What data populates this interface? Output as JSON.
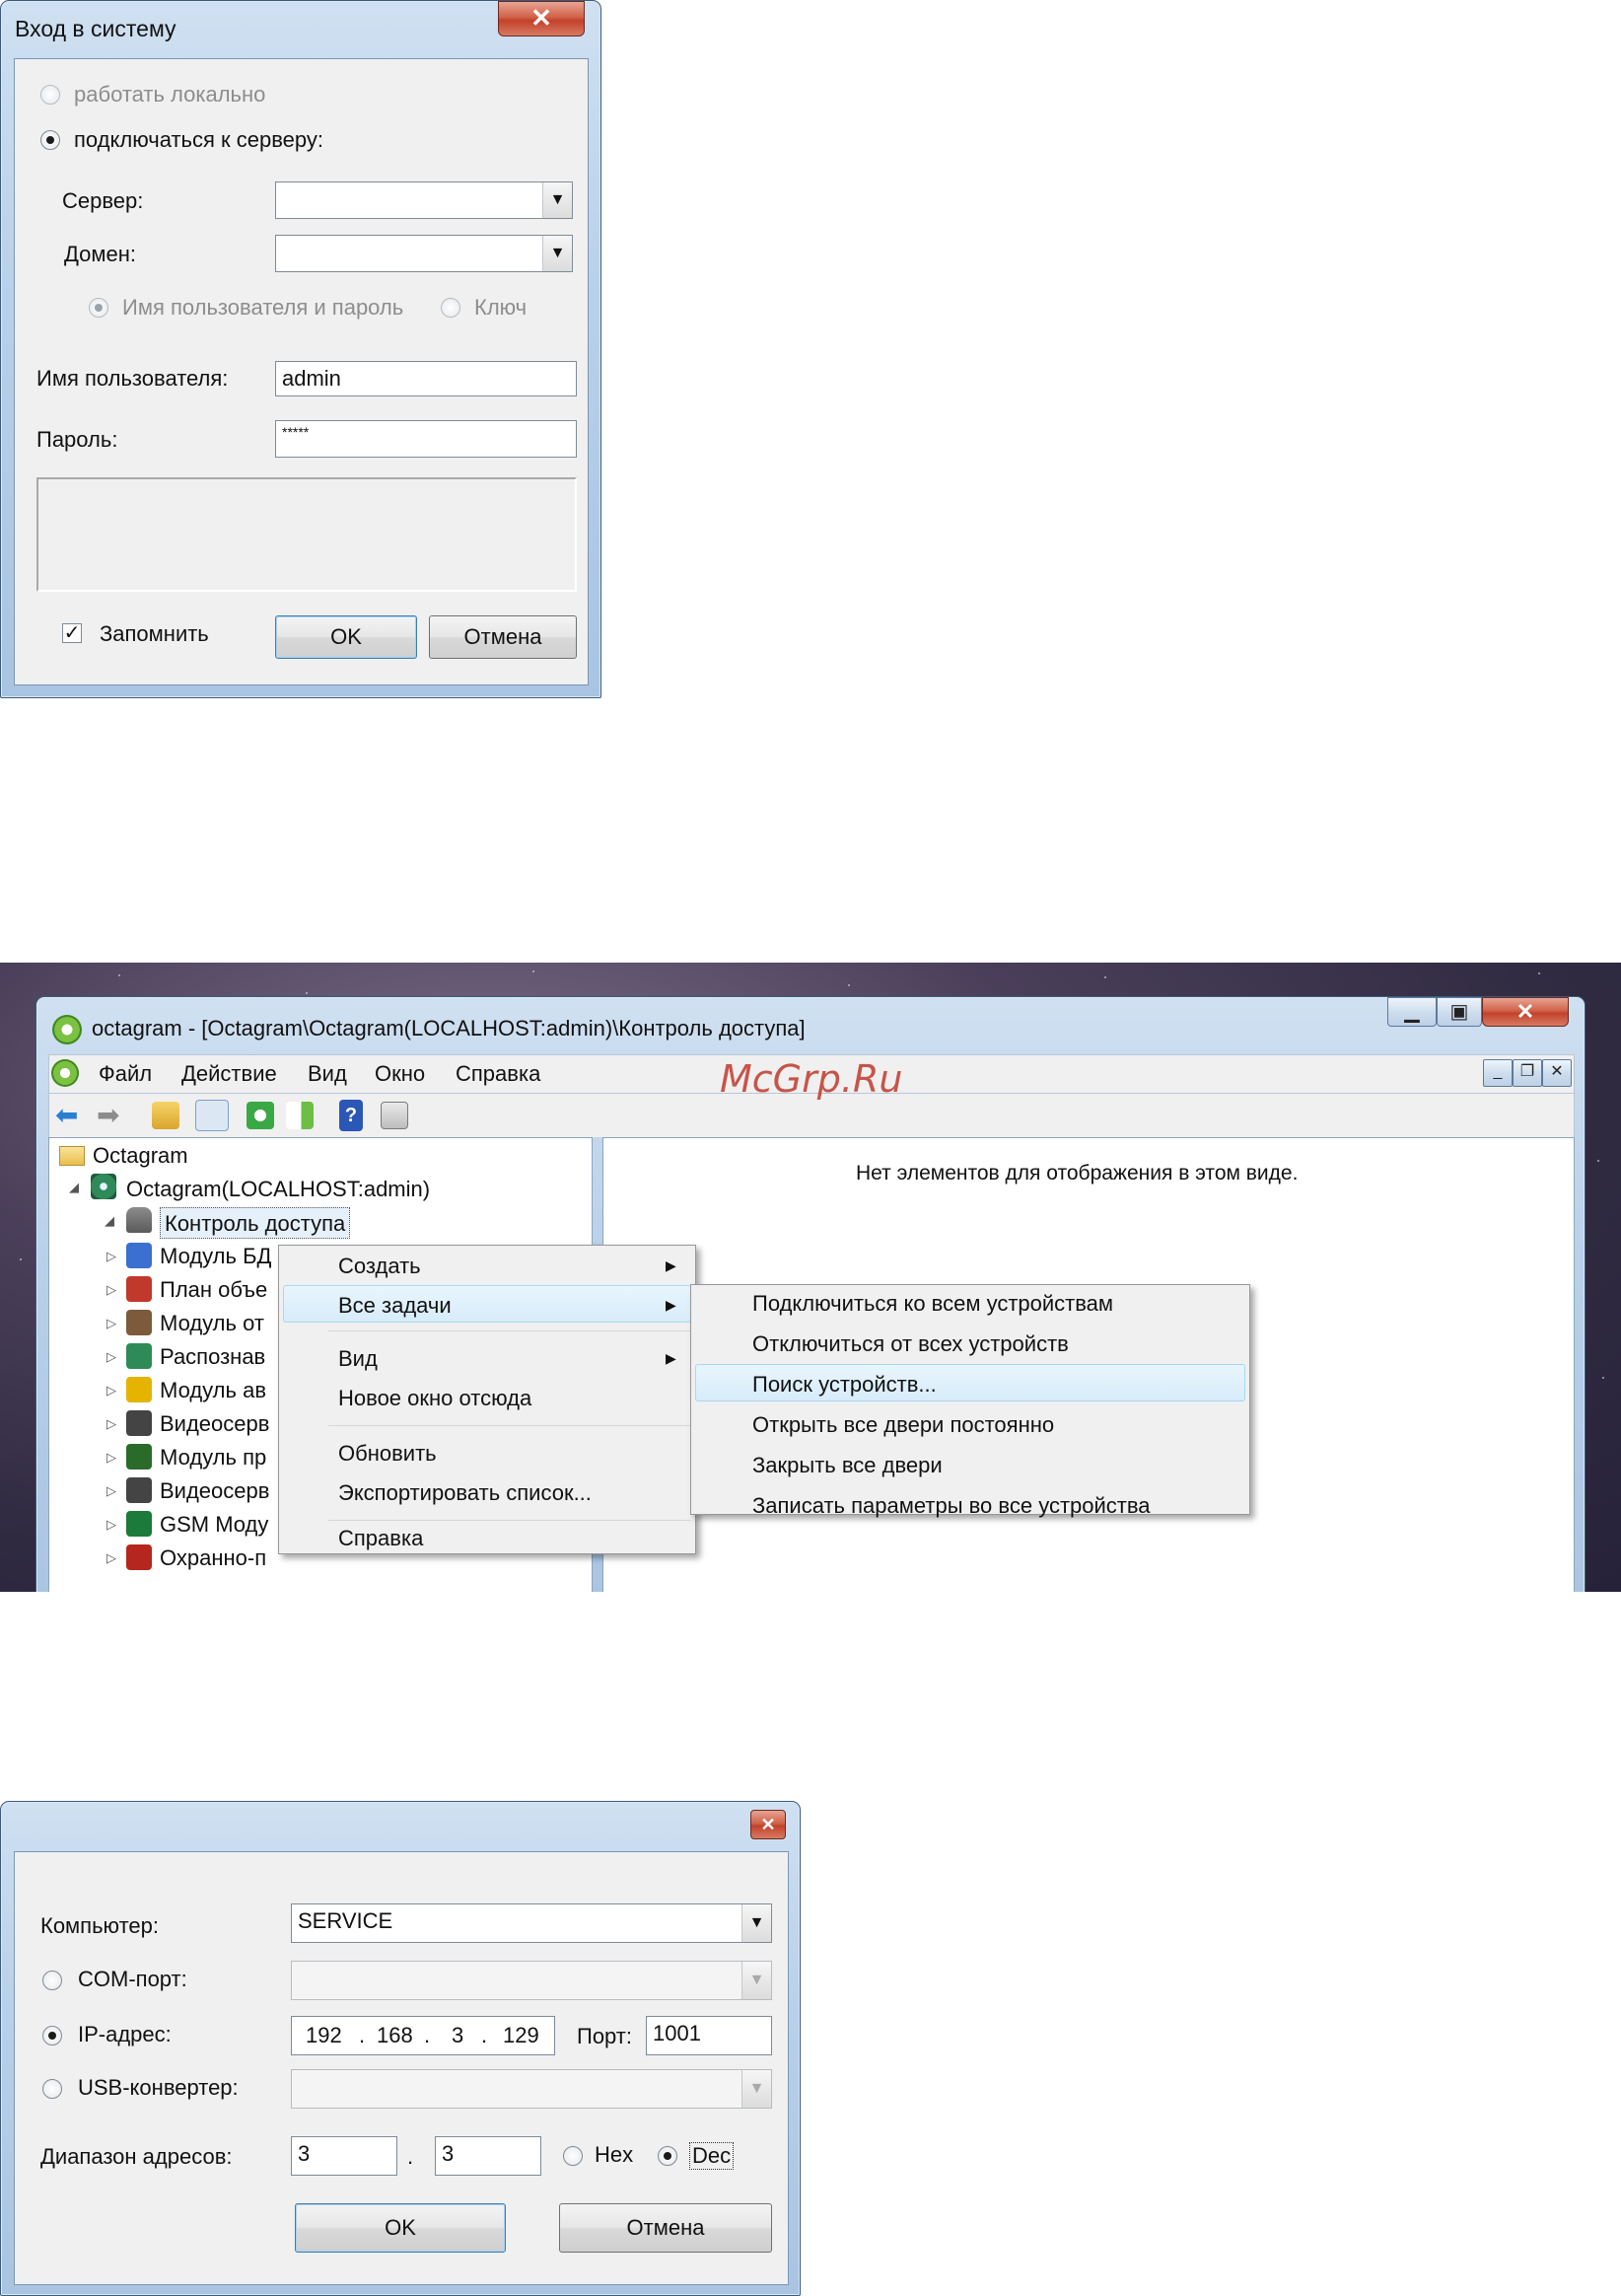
{
  "login": {
    "title": "Вход в систему",
    "close_glyph": "✕",
    "mode_local": "работать локально",
    "mode_server": "подключаться к серверу:",
    "server_label": "Сервер:",
    "server_value": "",
    "domain_label": "Домен:",
    "domain_value": "",
    "auth_userpass": "Имя пользователя и пароль",
    "auth_key": "Ключ",
    "username_label": "Имя пользователя:",
    "username_value": "admin",
    "password_label": "Пароль:",
    "password_value": "*****",
    "remember_label": "Запомнить",
    "ok": "OK",
    "cancel": "Отмена"
  },
  "app": {
    "title": "octagram - [Octagram\\Octagram(LOCALHOST:admin)\\Контроль доступа]",
    "menu": [
      "Файл",
      "Действие",
      "Вид",
      "Окно",
      "Справка"
    ],
    "watermark": "McGrp.Ru",
    "empty_message": "Нет элементов для отображения в этом виде.",
    "tree": {
      "root": "Octagram",
      "server": "Octagram(LOCALHOST:admin)",
      "selected": "Контроль доступа",
      "items": [
        "Модуль БД",
        "План объе",
        "Модуль от",
        "Распознав",
        "Модуль ав",
        "Видеосерв",
        "Модуль пр",
        "Видеосерв",
        "GSM Моду",
        "Охранно-п"
      ]
    },
    "context_menu": {
      "create": "Создать",
      "all_tasks": "Все задачи",
      "view": "Вид",
      "new_window": "Новое окно отсюда",
      "refresh": "Обновить",
      "export": "Экспортировать список...",
      "help": "Справка"
    },
    "submenu": [
      "Подключиться ко всем устройствам",
      "Отключиться от всех устройств",
      "Поиск устройств...",
      "Открыть все двери постоянно",
      "Закрыть все двери",
      "Записать параметры во все устройства"
    ],
    "icons": {
      "app": "gear-icon",
      "back": "arrow-left-icon",
      "forward": "arrow-right-icon"
    }
  },
  "search": {
    "computer_label": "Компьютер:",
    "computer_value": "SERVICE",
    "com_label": "COM-порт:",
    "ip_label": "IP-адрес:",
    "ip_octets": [
      "192",
      "168",
      "3",
      "129"
    ],
    "port_label": "Порт:",
    "port_value": "1001",
    "usb_label": "USB-конвертер:",
    "range_label": "Диапазон адресов:",
    "range_from": "3",
    "range_to": "3",
    "range_sep": ".",
    "hex": "Hex",
    "dec": "Dec",
    "ok": "OK",
    "cancel": "Отмена"
  }
}
